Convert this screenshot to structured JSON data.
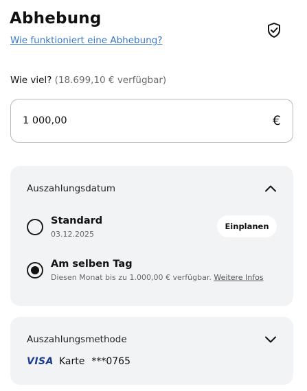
{
  "header": {
    "title": "Abhebung",
    "help_link": "Wie funktioniert eine Abhebung?"
  },
  "amount": {
    "label": "Wie viel?",
    "available": "(18.699,10 € verfügbar)",
    "value": "1 000,00",
    "currency": "€"
  },
  "payout_date": {
    "title": "Auszahlungsdatum",
    "options": [
      {
        "label": "Standard",
        "sub": "03.12.2025",
        "selected": false,
        "button": "Einplanen"
      },
      {
        "label": "Am selben Tag",
        "sub": "Diesen Monat bis zu 1.000,00 € verfügbar.",
        "link": "Weitere Infos",
        "selected": true
      }
    ]
  },
  "payout_method": {
    "title": "Auszahlungsmethode",
    "brand": "VISA",
    "type": "Karte",
    "masked": "***0765"
  },
  "colors": {
    "link": "#3a78c8",
    "card_bg": "#f2f3f5",
    "visa": "#1a3d96"
  }
}
